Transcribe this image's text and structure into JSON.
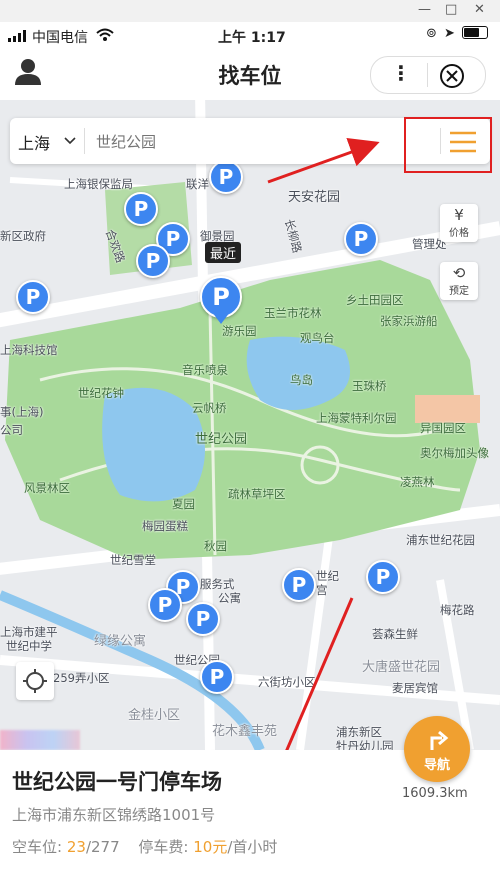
{
  "status_bar": {
    "carrier": "中国电信",
    "time": "上午 1:17"
  },
  "header": {
    "title": "找车位"
  },
  "search": {
    "city": "上海",
    "placeholder": "世纪公园"
  },
  "side_buttons": {
    "price_icon": "¥",
    "price_label": "价格",
    "reserve_label": "预定"
  },
  "map": {
    "latest_badge": "最近",
    "pin_glyph": "P",
    "labels": {
      "l1": "上海银保监局",
      "l2": "联洋",
      "l3": "天安花园",
      "l4": "新区政府",
      "l5": "合欢路",
      "l6": "御景园",
      "l7": "长柳路",
      "l8": "管理处",
      "l9": "乡土田园区",
      "l10": "玉兰市花林",
      "l11": "张家浜游船",
      "l12": "游乐园",
      "l13": "观鸟台",
      "l14": "上海科技馆",
      "l15": "音乐喷泉",
      "l16": "鸟岛",
      "l17": "玉珠桥",
      "l18": "世纪花钟",
      "l19": "云帆桥",
      "l20": "上海蒙特利尔园",
      "l21": "事(上海)",
      "l22": "公司",
      "l23": "世纪公园",
      "l24": "异国园区",
      "l25": "奥尔梅加头像",
      "l26": "凌燕林",
      "l27": "风景林区",
      "l28": "疏林草坪区",
      "l29": "夏园",
      "l30": "浦东世纪花园",
      "l31": "梅园蛋糕",
      "l32": "秋园",
      "l33": "世纪雪堂",
      "l34": "服务式",
      "l35": "公寓",
      "l36": "世纪",
      "l37": "宫",
      "l38": "梅花路",
      "l39": "上海市建平",
      "l40": "世纪中学",
      "l41": "绿缘公寓",
      "l42": "荟森生鲜",
      "l43": "大唐盛世花园",
      "l44": "世纪公园",
      "l45": "丹路259弄小区",
      "l46": "六街坊小区",
      "l47": "麦居宾馆",
      "l48": "金桂小区",
      "l49": "花木鑫丰苑",
      "l50": "浦东新区",
      "l51": "牡丹幼儿园"
    }
  },
  "card": {
    "name": "世纪公园一号门停车场",
    "address": "上海市浦东新区锦绣路1001号",
    "spaces_label": "空车位:",
    "spaces_free": "23",
    "spaces_total": "/277",
    "fee_label": "停车费:",
    "fee_value": "10元",
    "fee_unit": "/首小时",
    "nav_label": "导航",
    "distance": "1609.3km"
  },
  "colors": {
    "accent_orange": "#f0a030",
    "pin_blue": "#3d86f0",
    "park_green": "#a8d99a",
    "water_blue": "#8ec7ee",
    "annotation_red": "#e02020"
  }
}
